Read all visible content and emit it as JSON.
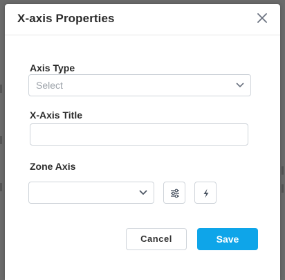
{
  "dialog": {
    "title": "X-axis Properties"
  },
  "fields": {
    "axis_type": {
      "label": "Axis Type",
      "placeholder": "Select"
    },
    "x_axis_title": {
      "label": "X-Axis Title",
      "value": ""
    },
    "zone_axis": {
      "label": "Zone Axis",
      "value": ""
    }
  },
  "buttons": {
    "cancel": "Cancel",
    "save": "Save"
  },
  "icons": {
    "close": "close-icon",
    "chevron": "chevron-down-icon",
    "settings": "sliders-icon",
    "action": "lightning-bolt-icon"
  },
  "colors": {
    "primary": "#0ea5e9",
    "backdrop": "#6b6b6b"
  }
}
